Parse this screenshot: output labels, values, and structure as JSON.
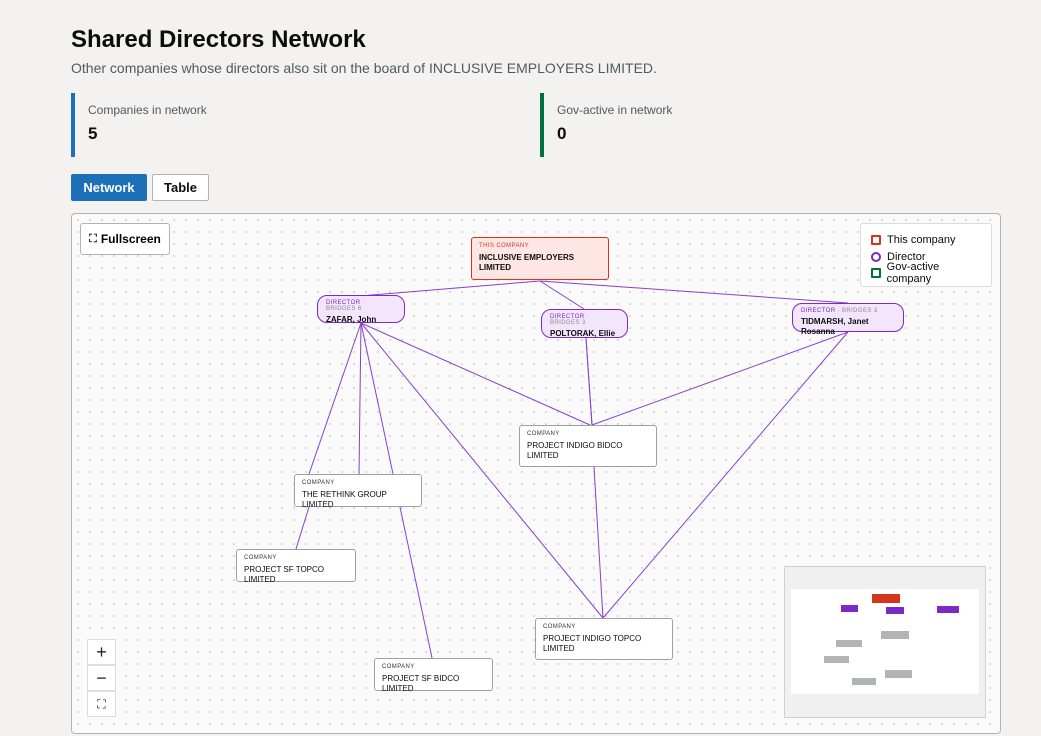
{
  "header": {
    "title": "Shared Directors Network",
    "subtitle": "Other companies whose directors also sit on the board of INCLUSIVE EMPLOYERS LIMITED."
  },
  "stats": [
    {
      "label": "Companies in network",
      "value": "5"
    },
    {
      "label": "Gov-active in network",
      "value": "0"
    }
  ],
  "tabs": {
    "network": "Network",
    "table": "Table",
    "active": "Network"
  },
  "controls": {
    "fullscreen": "Fullscreen",
    "zoom_in": "+",
    "zoom_out": "−",
    "fit": "⛶"
  },
  "legend": {
    "this_company": "This company",
    "director": "Director",
    "gov_active": "Gov-active company"
  },
  "colors": {
    "accent": "#1d70b8",
    "gov": "#00703c",
    "this_company": "#d4351c",
    "director": "#7a2bc7",
    "edge": "#8a3fc9"
  },
  "network": {
    "this_company": {
      "type": "THIS COMPANY",
      "name": "INCLUSIVE EMPLOYERS LIMITED"
    },
    "directors": [
      {
        "type": "DIRECTOR",
        "bridges": "· BRIDGES 6",
        "name": "ZAFAR, John"
      },
      {
        "type": "DIRECTOR",
        "bridges": "· BRIDGES 3",
        "name": "POLTORAK, Ellie"
      },
      {
        "type": "DIRECTOR",
        "bridges": "· BRIDGES 3",
        "name": "TIDMARSH, Janet Rosanna"
      }
    ],
    "companies": [
      {
        "type": "COMPANY",
        "name": "PROJECT INDIGO BIDCO LIMITED"
      },
      {
        "type": "COMPANY",
        "name": "THE RETHINK GROUP LIMITED"
      },
      {
        "type": "COMPANY",
        "name": "PROJECT SF TOPCO LIMITED"
      },
      {
        "type": "COMPANY",
        "name": "PROJECT INDIGO TOPCO LIMITED"
      },
      {
        "type": "COMPANY",
        "name": "PROJECT SF BIDCO LIMITED"
      }
    ],
    "edges": [
      [
        "this",
        "d0"
      ],
      [
        "this",
        "d1"
      ],
      [
        "this",
        "d2"
      ],
      [
        "d0",
        "c1"
      ],
      [
        "d0",
        "c1"
      ],
      [
        "d0",
        "c2"
      ],
      [
        "d0",
        "c4"
      ],
      [
        "d0",
        "c0"
      ],
      [
        "d0",
        "c3"
      ],
      [
        "d1",
        "c0"
      ],
      [
        "d1",
        "c0"
      ],
      [
        "d2",
        "c0"
      ],
      [
        "d2",
        "c3"
      ],
      [
        "c0",
        "c3"
      ]
    ]
  }
}
